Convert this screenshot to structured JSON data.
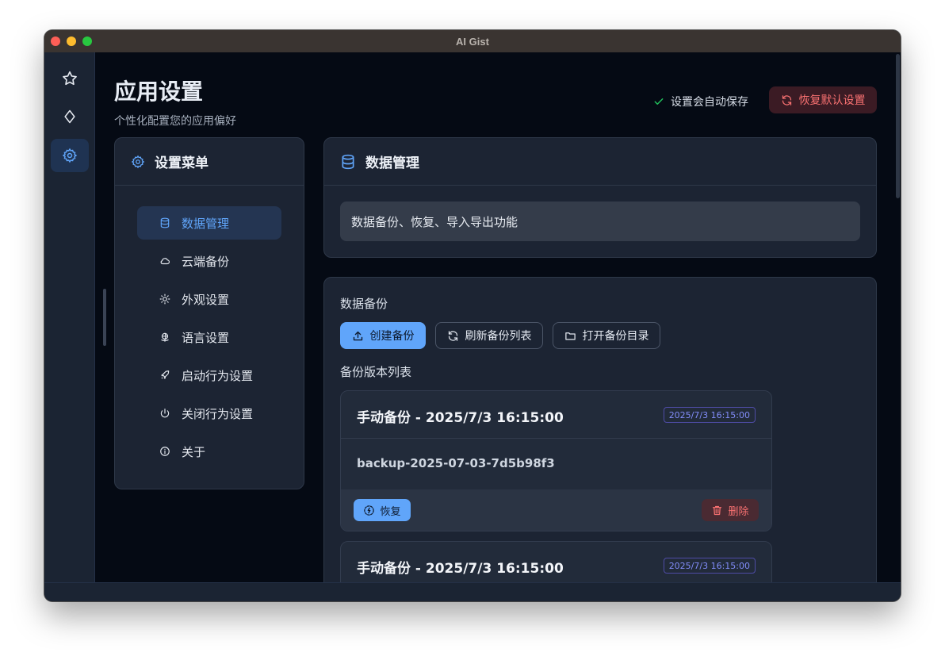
{
  "window": {
    "title": "AI Gist"
  },
  "colors": {
    "accent": "#60a5fa",
    "danger": "#f87171",
    "success": "#22c55e",
    "badge": "#818cf8"
  },
  "rail": {
    "items": [
      {
        "icon": "star-icon",
        "active": false
      },
      {
        "icon": "diamond-icon",
        "active": false
      },
      {
        "icon": "gear-icon",
        "active": true
      }
    ]
  },
  "header": {
    "title": "应用设置",
    "subtitle": "个性化配置您的应用偏好",
    "autosave_text": "设置会自动保存",
    "reset_label": "恢复默认设置"
  },
  "menu": {
    "title": "设置菜单",
    "items": [
      {
        "label": "数据管理",
        "icon": "database-icon",
        "active": true
      },
      {
        "label": "云端备份",
        "icon": "cloud-icon",
        "active": false
      },
      {
        "label": "外观设置",
        "icon": "sun-icon",
        "active": false
      },
      {
        "label": "语言设置",
        "icon": "globe-icon",
        "active": false
      },
      {
        "label": "启动行为设置",
        "icon": "rocket-icon",
        "active": false
      },
      {
        "label": "关闭行为设置",
        "icon": "power-icon",
        "active": false
      },
      {
        "label": "关于",
        "icon": "info-icon",
        "active": false
      }
    ]
  },
  "section": {
    "title": "数据管理",
    "description": "数据备份、恢复、导入导出功能"
  },
  "backup": {
    "heading": "数据备份",
    "create_label": "创建备份",
    "refresh_label": "刷新备份列表",
    "open_dir_label": "打开备份目录",
    "list_heading": "备份版本列表",
    "entries": [
      {
        "title": "手动备份 - 2025/7/3 16:15:00",
        "badge": "2025/7/3 16:15:00",
        "file": "backup-2025-07-03-7d5b98f3",
        "restore_label": "恢复",
        "delete_label": "删除"
      },
      {
        "title": "手动备份 - 2025/7/3 16:15:00",
        "badge": "2025/7/3 16:15:00"
      }
    ]
  }
}
